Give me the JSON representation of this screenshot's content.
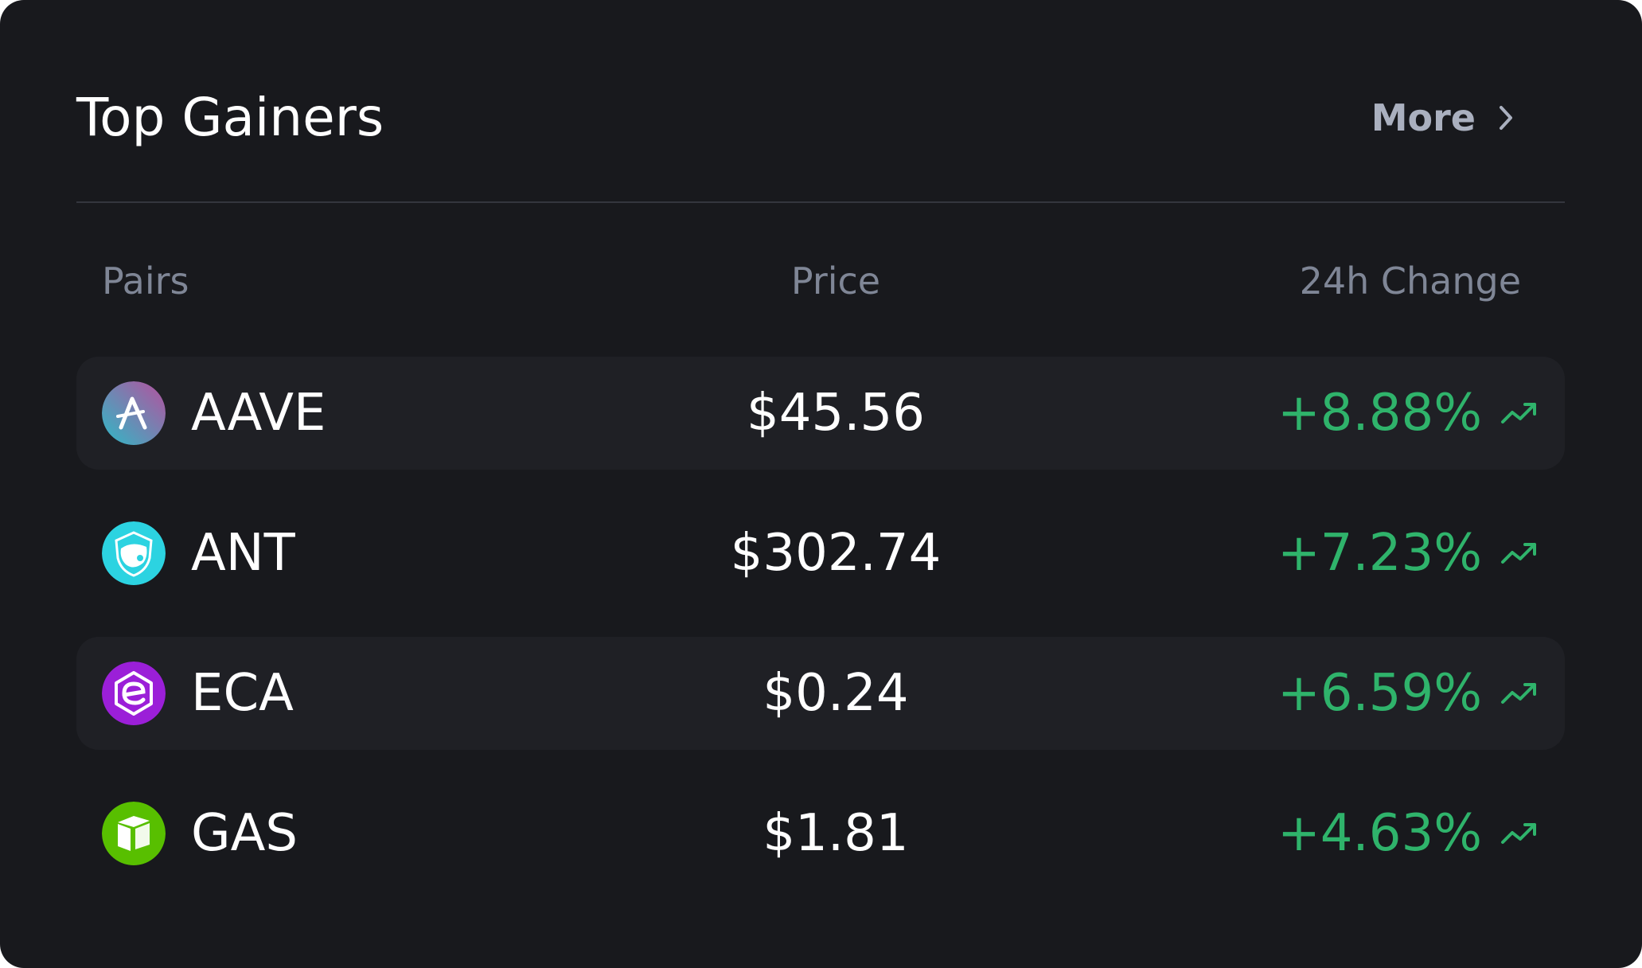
{
  "widget": {
    "title": "Top Gainers",
    "more_label": "More",
    "more_icon": "chevron-right-icon"
  },
  "columns": {
    "pairs": "Pairs",
    "price": "Price",
    "change": "24h Change"
  },
  "colors": {
    "background": "#18191d",
    "row_shade": "#1f2025",
    "positive": "#2fb36b",
    "muted": "#7f8696"
  },
  "rows": [
    {
      "symbol": "AAVE",
      "price": "$45.56",
      "change": "+8.88%",
      "icon": "aave-logo-icon",
      "trend_icon": "trending-up-icon"
    },
    {
      "symbol": "ANT",
      "price": "$302.74",
      "change": "+7.23%",
      "icon": "aragon-logo-icon",
      "trend_icon": "trending-up-icon"
    },
    {
      "symbol": "ECA",
      "price": "$0.24",
      "change": "+6.59%",
      "icon": "electra-logo-icon",
      "trend_icon": "trending-up-icon"
    },
    {
      "symbol": "GAS",
      "price": "$1.81",
      "change": "+4.63%",
      "icon": "neo-gas-logo-icon",
      "trend_icon": "trending-up-icon"
    }
  ]
}
